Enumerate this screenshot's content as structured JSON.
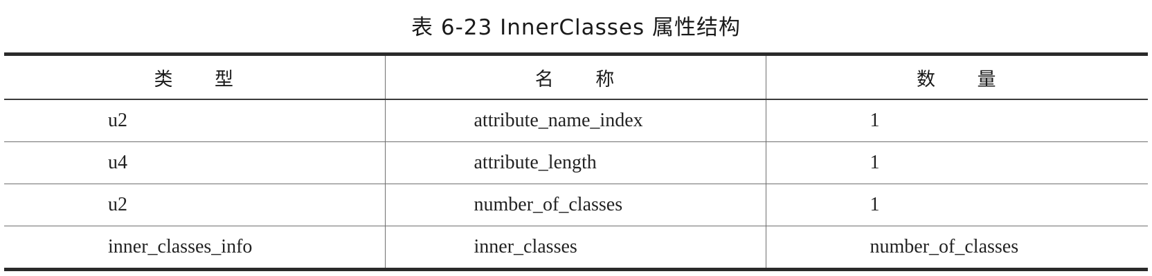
{
  "caption": "表 6-23   InnerClasses 属性结构",
  "table": {
    "headers": [
      "类 型",
      "名 称",
      "数 量"
    ],
    "rows": [
      {
        "type": "u2",
        "name": "attribute_name_index",
        "count": "1"
      },
      {
        "type": "u4",
        "name": "attribute_length",
        "count": "1"
      },
      {
        "type": "u2",
        "name": "number_of_classes",
        "count": "1"
      },
      {
        "type": "inner_classes_info",
        "name": "inner_classes",
        "count": "number_of_classes"
      }
    ]
  }
}
